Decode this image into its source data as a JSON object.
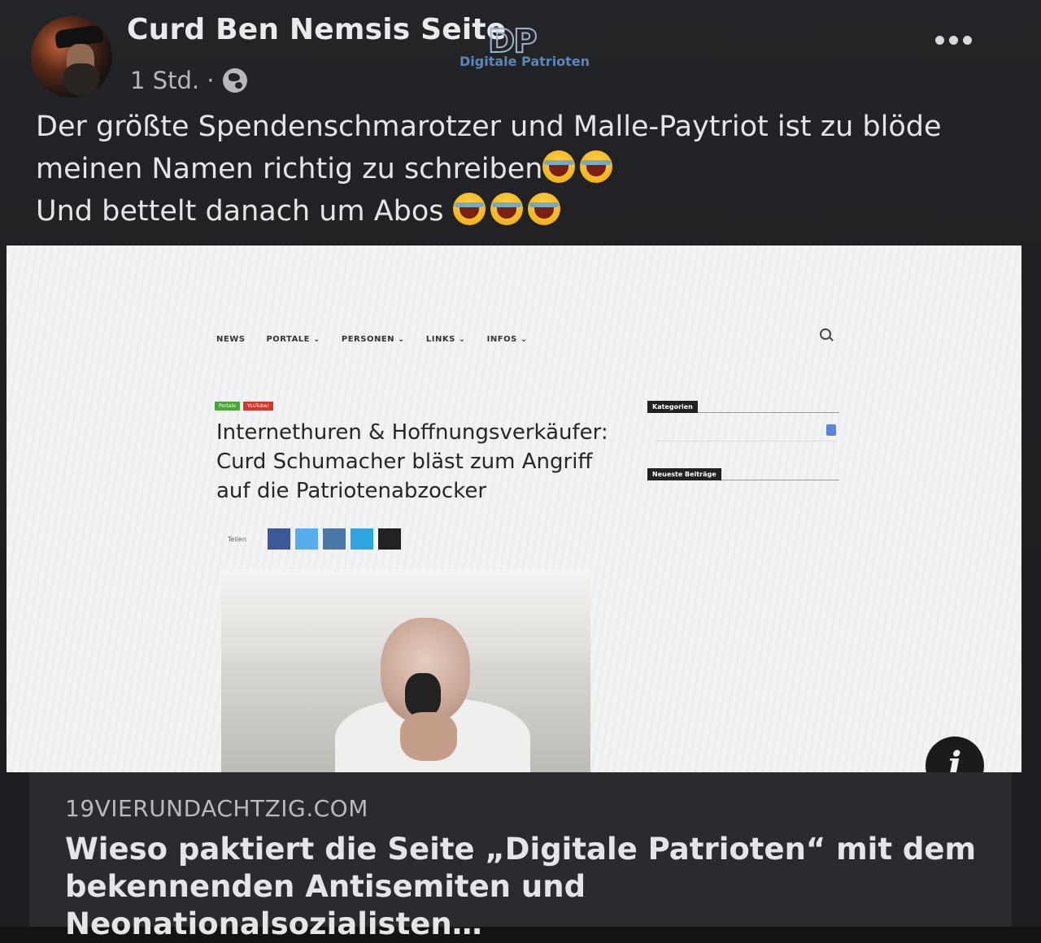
{
  "post": {
    "author": "Curd Ben Nemsis Seite",
    "time": "1 Std. ·",
    "text_lines": [
      "Der größte Spendenschmarotzer und Malle-Paytriot ist zu blöde",
      "meinen Namen richtig zu schreiben",
      "Und bettelt danach um Abos "
    ]
  },
  "preview": {
    "site_logo": "DP",
    "site_name": "Digitale Patrioten",
    "nav": [
      "NEWS",
      "PORTALE ⌄",
      "PERSONEN ⌄",
      "LINKS ⌄",
      "INFOS ⌄"
    ],
    "tags": [
      "Portale",
      "YouTuber"
    ],
    "article_title": "Internethuren & Hoffnungsverkäufer: Curd Schumacher bläst zum Angriff auf die Patriotenabzocker",
    "share_label": "Teilen",
    "share_colors": [
      "#3b5998",
      "#55acee",
      "#4a76a8",
      "#2ca5e0",
      "#222222"
    ],
    "sidebar": {
      "heading_1": "Kategorien",
      "heading_2": "Neueste Beiträge"
    }
  },
  "link": {
    "domain": "19VIERUNDACHTZIG.COM",
    "headline": "Wieso paktiert die Seite „Digitale Patrioten“ mit dem bekennenden Antisemiten und Neonationalsozialisten…"
  }
}
